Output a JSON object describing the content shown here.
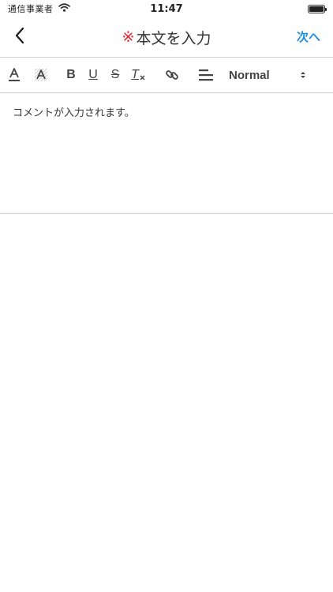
{
  "status_bar": {
    "carrier": "通信事業者",
    "time": "11:47"
  },
  "nav": {
    "required_mark": "※",
    "title": "本文を入力",
    "next_label": "次へ"
  },
  "toolbar": {
    "bold_label": "B",
    "underline_label": "U",
    "strike_label": "S",
    "clear_format_label": "T",
    "format_value": "Normal"
  },
  "editor": {
    "text": "コメントが入力されます。"
  },
  "colors": {
    "accent": "#1a8fe3",
    "required": "#e5202e",
    "divider": "#cfcfcf"
  }
}
